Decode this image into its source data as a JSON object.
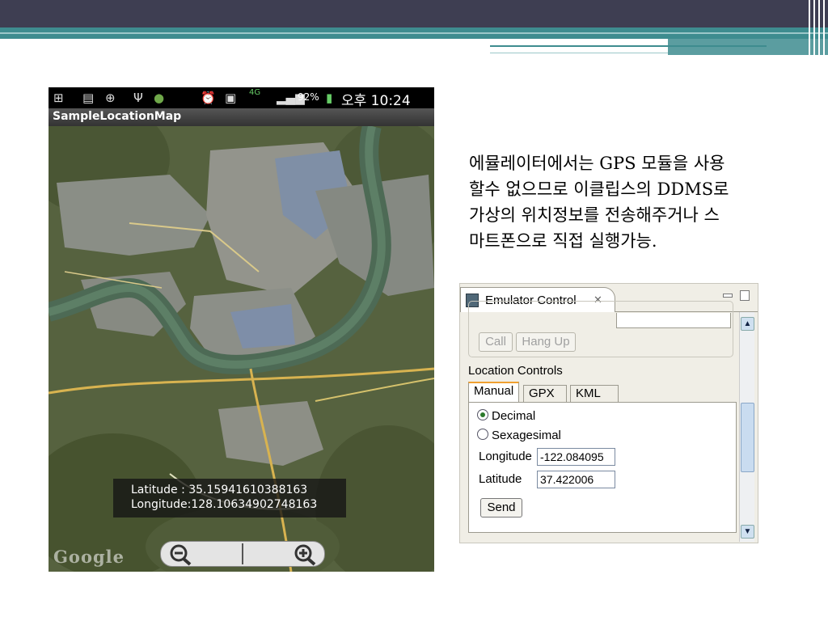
{
  "phone": {
    "status_bar": {
      "battery": "92%",
      "network": "4G",
      "time": "오후 10:24"
    },
    "app_title": "SampleLocationMap",
    "map": {
      "latitude_text": "Latitude : 35.15941610388163",
      "longitude_text": "Longitude:128.10634902748163",
      "logo": "Google",
      "zoom_out_icon": "zoom-out-icon",
      "zoom_in_icon": "zoom-in-icon"
    }
  },
  "description": {
    "lines": [
      "에뮬레이터에서는 GPS 모듈을 사용",
      "할수 없으므로 이클립스의 DDMS로",
      "가상의 위치정보를 전송해주거나 스",
      "마트폰으로 직접 실행가능."
    ]
  },
  "emulator_control": {
    "tab_title": "Emulator Control",
    "close_glyph": "✕",
    "call_label": "Call",
    "hang_up_label": "Hang Up",
    "location_controls_label": "Location Controls",
    "tabs": [
      "Manual",
      "GPX",
      "KML"
    ],
    "radio_options": [
      {
        "label": "Decimal",
        "checked": true
      },
      {
        "label": "Sexagesimal",
        "checked": false
      }
    ],
    "longitude_label": "Longitude",
    "longitude_value": "-122.084095",
    "latitude_label": "Latitude",
    "latitude_value": "37.422006",
    "send_label": "Send"
  },
  "colors": {
    "header_dark": "#3e3e52",
    "header_teal": "#3e8c8f",
    "selected_tab_accent": "#f0a030"
  }
}
